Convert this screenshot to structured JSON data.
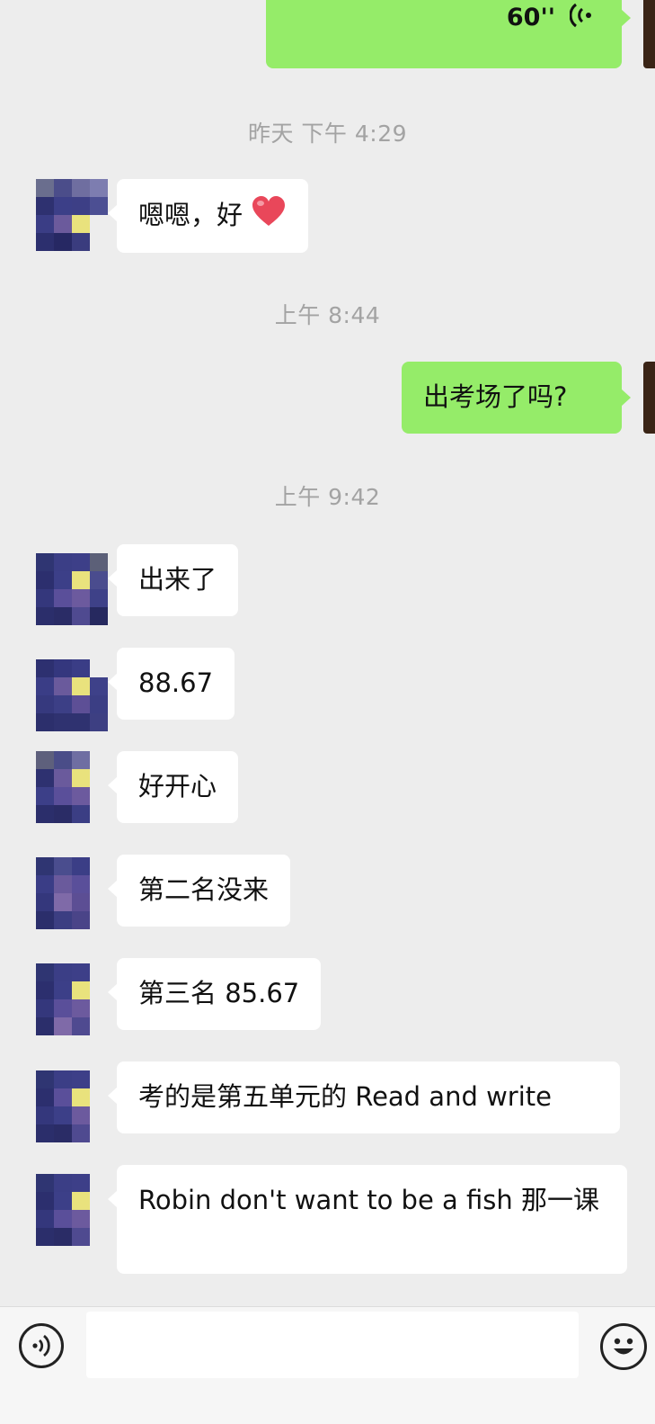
{
  "messages": {
    "voice": {
      "duration": "60''"
    },
    "ts1": "昨天 下午 4:29",
    "m1": "嗯嗯，好",
    "ts2": "上午 8:44",
    "m2": "出考场了吗?",
    "ts3": "上午 9:42",
    "m3": "出来了",
    "m4": "88.67",
    "m5": "好开心",
    "m6": "第二名没来",
    "m7": "第三名 85.67",
    "m8": "考的是第五单元的 Read and write",
    "m9": "Robin don't want to be a fish 那一课"
  },
  "input": {
    "placeholder": ""
  },
  "icons": {
    "voice_mode": "voice-mode-icon",
    "emoji": "emoji-icon",
    "heart": "heart-emoji-icon",
    "voice_wave": "voice-wave-icon"
  },
  "colors": {
    "background": "#ededed",
    "outgoing_bubble": "#95ec69",
    "incoming_bubble": "#ffffff",
    "timestamp": "#a3a3a3",
    "avatar_palette": [
      "#2f3572",
      "#3d3f8a",
      "#5a4f9a",
      "#7f6aa8",
      "#e8e07a",
      "#222558"
    ]
  }
}
